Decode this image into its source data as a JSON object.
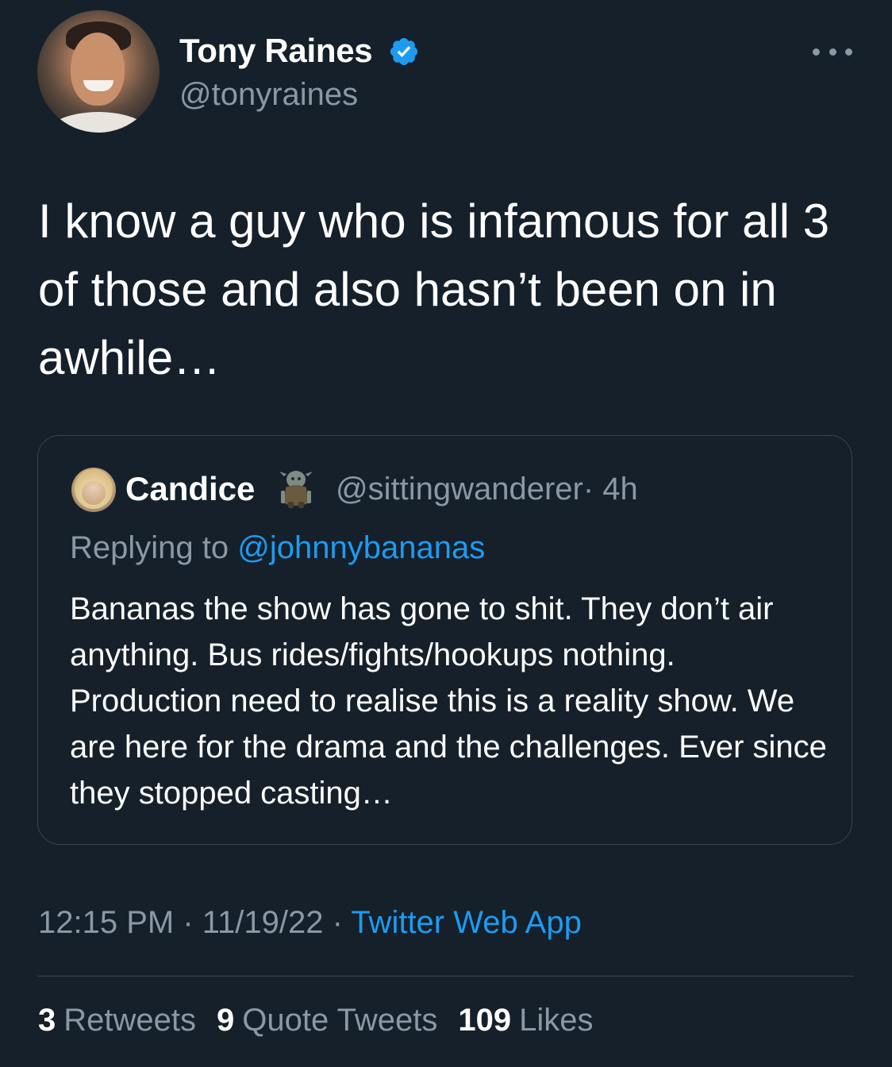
{
  "author": {
    "display_name": "Tony Raines",
    "handle": "@tonyraines",
    "verified_icon": "verified-badge-icon"
  },
  "tweet": {
    "text": "I know a guy who is infamous for all 3 of those and also hasn’t been on in awhile…"
  },
  "quoted_tweet": {
    "display_name": "Candice",
    "handle": "@sittingwanderer",
    "time": "· 4h",
    "replying_prefix": "Replying to",
    "replying_to": "@johnnybananas",
    "text": "Bananas the show has gone to shit. They don’t air anything. Bus rides/fights/hookups nothing. Production need to realise this is a reality show. We are here for the drama and the challenges. Ever since they stopped casting…"
  },
  "meta": {
    "time": "12:15 PM",
    "sep1": " · ",
    "date": "11/19/22",
    "sep2": " · ",
    "source": "Twitter Web App"
  },
  "stats": {
    "retweets_count": "3",
    "retweets_label": "Retweets",
    "quotes_count": "9",
    "quotes_label": "Quote Tweets",
    "likes_count": "109",
    "likes_label": "Likes"
  },
  "colors": {
    "background": "#15202b",
    "accent": "#1d9bf0",
    "secondary_text": "#8b98a5",
    "border": "#38444d"
  }
}
